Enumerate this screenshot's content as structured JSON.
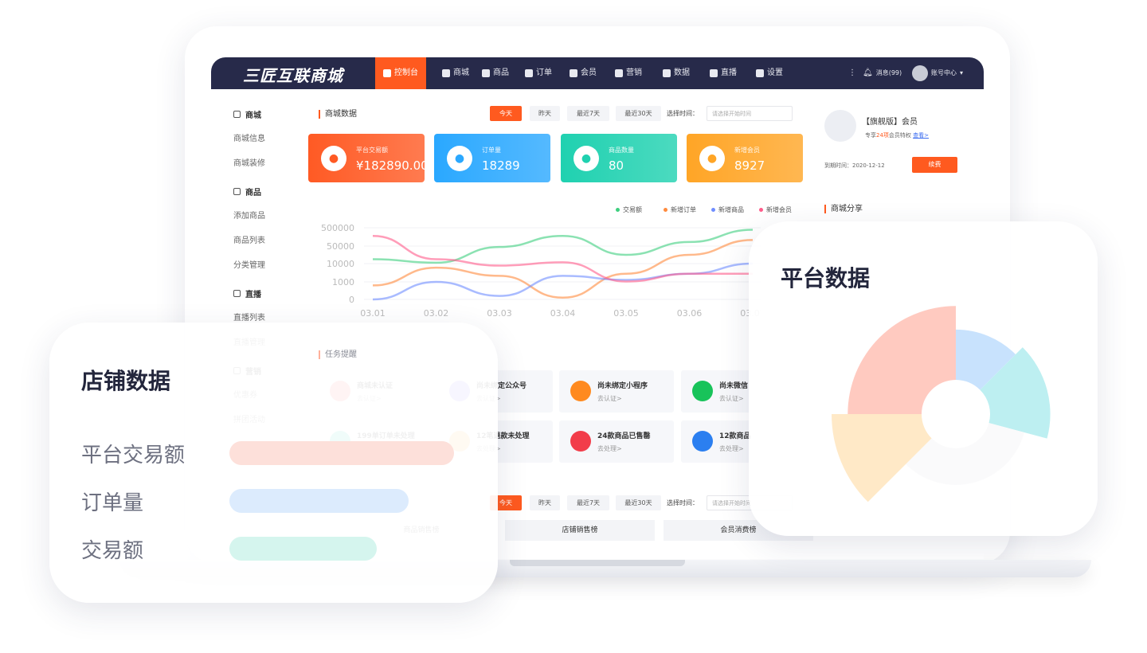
{
  "nav": {
    "logo": "三匠互联商城",
    "items": [
      {
        "label": "控制台",
        "icon": "home-icon",
        "active": true
      },
      {
        "label": "商城",
        "icon": "shop-icon"
      },
      {
        "label": "商品",
        "icon": "bag-icon"
      },
      {
        "label": "订单",
        "icon": "order-icon"
      },
      {
        "label": "会员",
        "icon": "user-icon"
      },
      {
        "label": "营销",
        "icon": "marketing-icon"
      },
      {
        "label": "数据",
        "icon": "pie-icon"
      },
      {
        "label": "直播",
        "icon": "live-icon"
      },
      {
        "label": "设置",
        "icon": "gear-icon"
      }
    ],
    "messages": "消息(99)",
    "account": "账号中心"
  },
  "sidebar": [
    {
      "label": "商城",
      "header": true
    },
    {
      "label": "商城信息"
    },
    {
      "label": "商城装修"
    },
    {
      "label": "商品",
      "header": true
    },
    {
      "label": "添加商品"
    },
    {
      "label": "商品列表"
    },
    {
      "label": "分类管理"
    },
    {
      "label": "直播",
      "header": true
    },
    {
      "label": "直播列表"
    },
    {
      "label": "直播管理"
    },
    {
      "label": "营销",
      "header": true
    },
    {
      "label": "优惠券"
    },
    {
      "label": "拼团活动"
    }
  ],
  "main": {
    "title": "商城数据",
    "filters": [
      "今天",
      "昨天",
      "最近7天",
      "最近30天"
    ],
    "time_label": "选择时间：",
    "time_placeholder": "请选择开始时间",
    "stats": [
      {
        "label": "平台交易额",
        "value": "¥182890.00",
        "color": "#ff5a24",
        "icon": "money-bag-icon"
      },
      {
        "label": "订单量",
        "value": "18289",
        "color": "#2aa8ff",
        "icon": "clipboard-icon"
      },
      {
        "label": "商品数量",
        "value": "80",
        "color": "#1fd1b0",
        "icon": "cart-icon"
      },
      {
        "label": "新增会员",
        "value": "8927",
        "color": "#ffa526",
        "icon": "diamond-icon"
      }
    ],
    "tasks_title": "任务提醒",
    "tasks": [
      {
        "title": "商城未认证",
        "link": "去认证>",
        "color": "#ff6b6b"
      },
      {
        "title": "尚未绑定公众号",
        "link": "去认证>",
        "color": "#8b7bff"
      },
      {
        "title": "尚未绑定小程序",
        "link": "去认证>",
        "color": "#ff8a1f"
      },
      {
        "title": "尚未微信",
        "link": "去认证>",
        "color": "#18c35a"
      },
      {
        "title": "199单订单未处理",
        "link": "去处理>",
        "color": "#2fd2b8"
      },
      {
        "title": "12笔退款未处理",
        "link": "去处理>",
        "color": "#ffb84d"
      },
      {
        "title": "24款商品已售罄",
        "link": "去处理>",
        "color": "#f23d4a"
      },
      {
        "title": "12款商品",
        "link": "去处理>",
        "color": "#2b7ff0"
      }
    ],
    "rank_tabs": [
      "商品销售榜",
      "店铺销售榜",
      "会员消费榜"
    ]
  },
  "chart_data": {
    "type": "line",
    "categories": [
      "03.01",
      "03.02",
      "03.03",
      "03.04",
      "03.05",
      "03.06",
      "03.07"
    ],
    "yticks": [
      "500000",
      "50000",
      "10000",
      "1000",
      "0"
    ],
    "series": [
      {
        "name": "交易额",
        "color": "#3ecf7f",
        "values": [
          20000,
          12000,
          48000,
          300000,
          30000,
          150000,
          450000
        ]
      },
      {
        "name": "新增订单",
        "color": "#ff8a3d",
        "values": [
          800,
          8000,
          4000,
          100,
          5000,
          30000,
          200000
        ]
      },
      {
        "name": "新增商品",
        "color": "#6f8dff",
        "values": [
          0,
          1000,
          200,
          4000,
          2000,
          5000,
          10000
        ]
      },
      {
        "name": "新增会员",
        "color": "#ff5c8a",
        "values": [
          300000,
          20000,
          9000,
          13000,
          1200,
          5000,
          5000
        ]
      }
    ]
  },
  "member": {
    "title": "【旗舰版】会员",
    "perk_prefix": "专享",
    "perk_num": "24项",
    "perk_suffix": "会员特权",
    "view_link": "查看>",
    "expiry": "到期时间：2020-12-12",
    "renew": "续费",
    "share_title": "商城分享"
  },
  "store_card": {
    "title": "店铺数据",
    "rows": [
      {
        "label": "平台交易额",
        "fill": 0.84,
        "color": "#fde0da"
      },
      {
        "label": "订单量",
        "fill": 0.67,
        "color": "#dcebfd"
      },
      {
        "label": "交易额",
        "fill": 0.55,
        "color": "#d5f5ee"
      }
    ]
  },
  "platform_card": {
    "title": "平台数据",
    "rose": [
      {
        "start": 0,
        "end": 45,
        "radius": 0.68,
        "color": "#c8e2fd"
      },
      {
        "start": 45,
        "end": 105,
        "radius": 0.76,
        "color": "#bdeff1"
      },
      {
        "start": 105,
        "end": 225,
        "radius": 0.57,
        "color": "#fafafb"
      },
      {
        "start": 225,
        "end": 270,
        "radius": 1.0,
        "color": "#ffe9c7"
      },
      {
        "start": 270,
        "end": 360,
        "radius": 0.87,
        "color": "#ffcac0"
      }
    ]
  }
}
